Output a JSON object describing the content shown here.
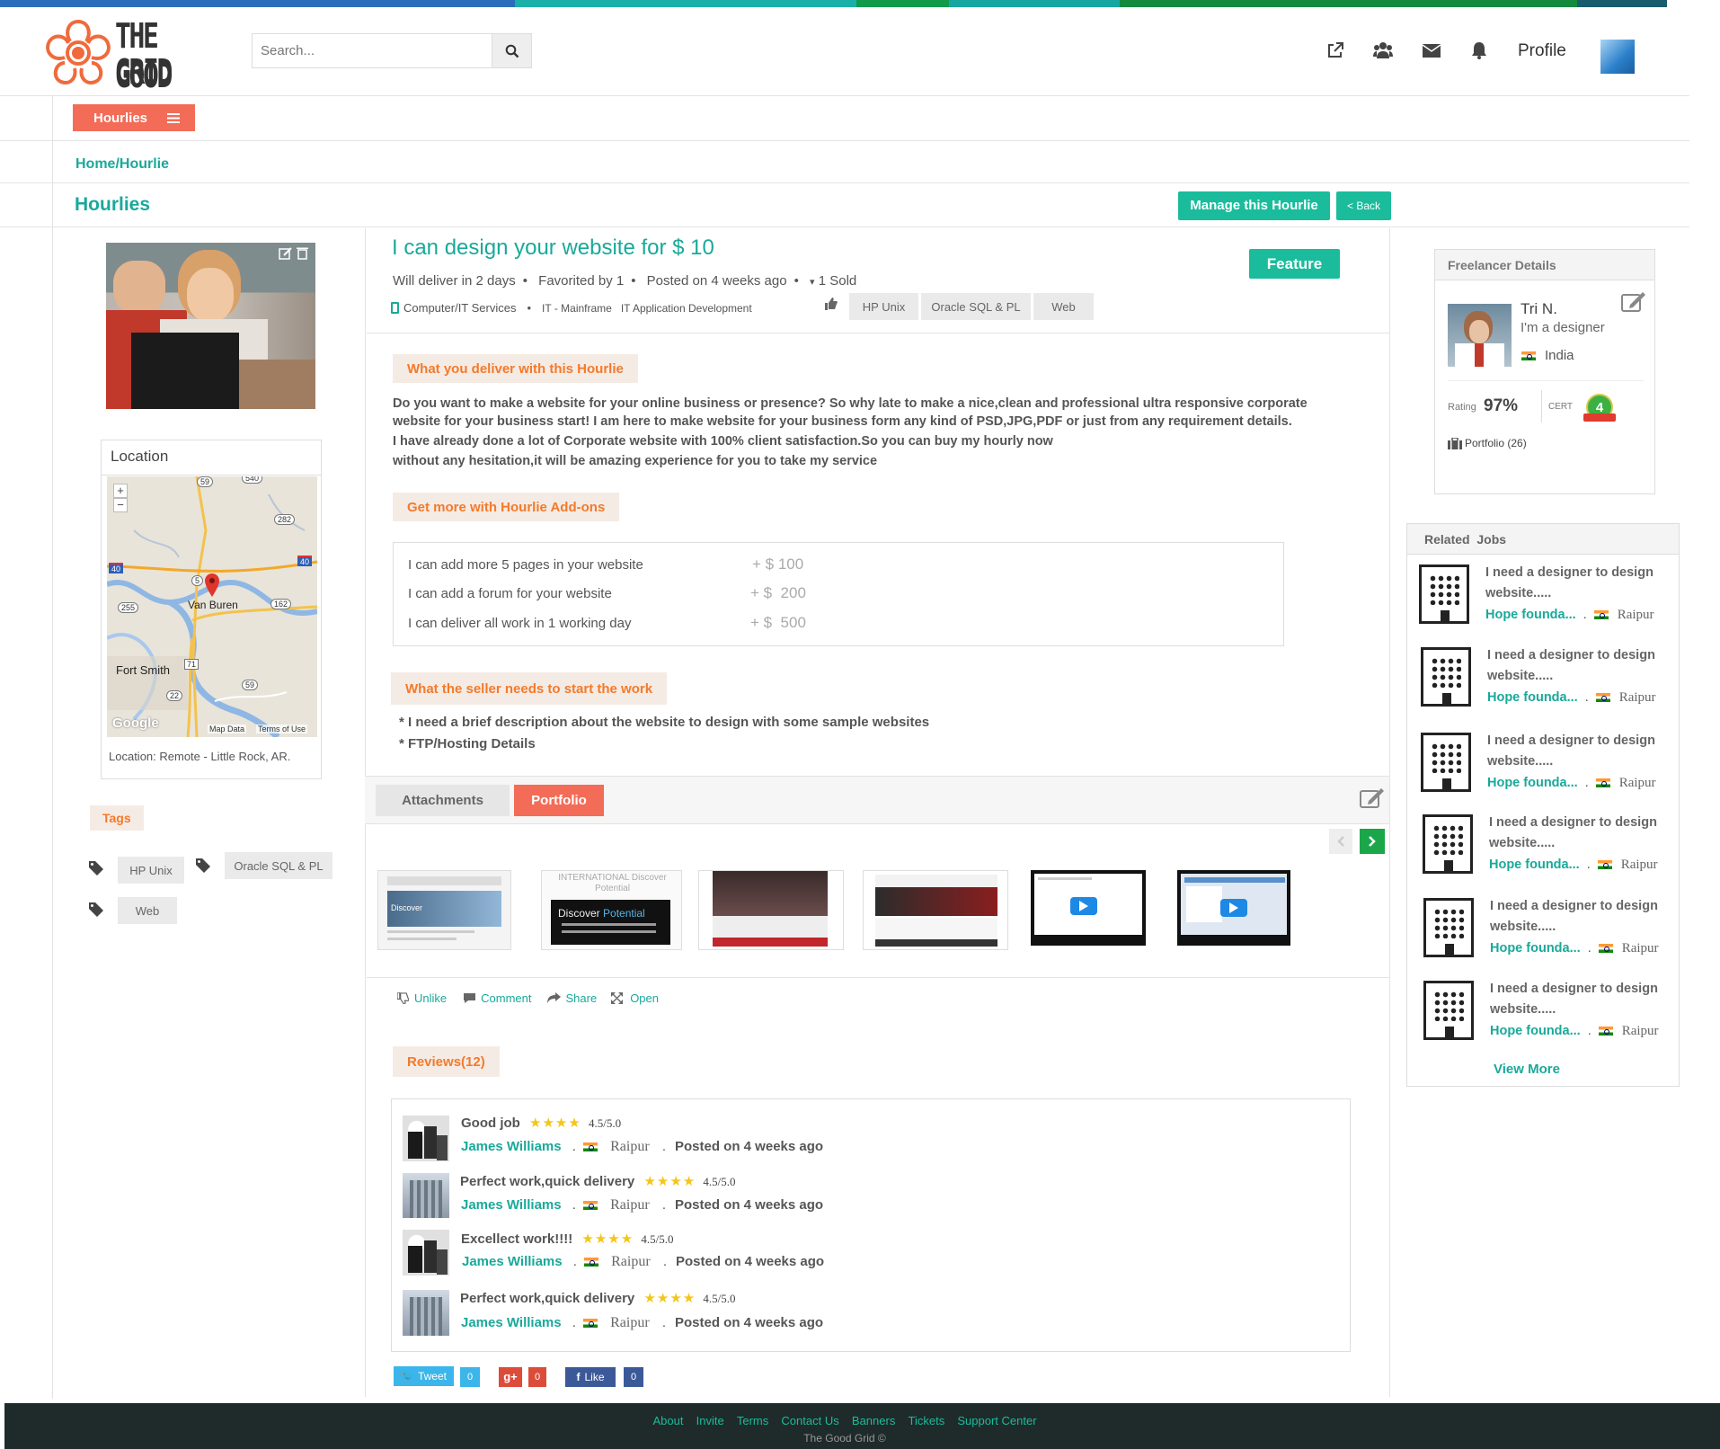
{
  "header": {
    "logo_text_top": "THE GOOD",
    "logo_text_bottom": "GRID",
    "search_placeholder": "Search...",
    "profile_label": "Profile",
    "icons": [
      "external-link-icon",
      "users-icon",
      "envelope-icon",
      "bell-icon"
    ]
  },
  "nav": {
    "menu_button_label": "Hourlies",
    "breadcrumb": "Home/Hourlie",
    "section_title": "Hourlies",
    "manage_button": "Manage this Hourlie",
    "back_button": "< Back"
  },
  "hourlie": {
    "title": "I can design your website for $ 10",
    "feature_button": "Feature",
    "deliver": "Will deliver in 2 days",
    "favorited": "Favorited by 1",
    "posted": "Posted on 4 weeks ago",
    "sold": "1 Sold",
    "category": "Computer/IT Services",
    "subcategory1": "IT - Mainframe",
    "subcategory2": "IT Application Development",
    "skills": [
      "HP Unix",
      "Oracle SQL & PL",
      "Web"
    ],
    "deliver_heading": "What you deliver with this Hourlie",
    "description": [
      "Do you want to make a website for your online business or presence? So why late to make a nice,clean and professional ultra responsive corporate",
      "website for your business start!   I am here to make website for your business form any kind of PSD,JPG,PDF or just from any requirement details.",
      "I have already done a lot of Corporate website with 100% client satisfaction.So you can buy my hourly now",
      "without any hesitation,it will be amazing experience for you to take my service"
    ],
    "addons_heading": "Get more with Hourlie Add-ons",
    "addons": [
      {
        "label": "I can add more 5 pages in your website",
        "price": "+ $ 100"
      },
      {
        "label": "I can add a forum for your website",
        "price": "+ $  200"
      },
      {
        "label": "I can deliver all work in 1 working day",
        "price": "+ $  500"
      }
    ],
    "requirements_heading": "What the seller needs to start the work",
    "requirements": [
      "* I need a brief description about the website to design with some sample websites",
      "* FTP/Hosting Details"
    ]
  },
  "tabs": {
    "attachments": "Attachments",
    "portfolio": "Portfolio"
  },
  "portfolio_thumbs": [
    "Discover",
    "INTERNATIONAL Discover Potential",
    "shoe-store",
    "shoe-store-2",
    "video",
    "video-2"
  ],
  "actions": {
    "unlike": "Unlike",
    "comment": "Comment",
    "share": "Share",
    "open": "Open"
  },
  "reviews": {
    "heading": "Reviews(12)",
    "items": [
      {
        "title": "Good job",
        "stars": "★★★★",
        "rating": "4.5/5.0",
        "name": "James Williams",
        "city": "Raipur",
        "posted": "Posted on 4 weeks ago"
      },
      {
        "title": "Perfect work,quick delivery",
        "stars": "★★★★",
        "rating": "4.5/5.0",
        "name": "James Williams",
        "city": "Raipur",
        "posted": "Posted on 4 weeks ago"
      },
      {
        "title": "Excellect work!!!!",
        "stars": "★★★★",
        "rating": "4.5/5.0",
        "name": "James Williams",
        "city": "Raipur",
        "posted": "Posted on 4 weeks ago"
      },
      {
        "title": "Perfect work,quick delivery",
        "stars": "★★★★",
        "rating": "4.5/5.0",
        "name": "James Williams",
        "city": "Raipur",
        "posted": "Posted on 4 weeks ago"
      }
    ]
  },
  "social": {
    "tweet": "Tweet",
    "tweet_count": "0",
    "gplus": "g+",
    "gplus_count": "0",
    "like": "Like",
    "like_count": "0"
  },
  "location": {
    "heading": "Location",
    "text": "Location: Remote - Little Rock, AR.",
    "map_labels": {
      "city1": "Van Buren",
      "city2": "Fort Smith",
      "google": "Google",
      "map_data": "Map Data",
      "terms": "Terms of Use",
      "r59": "59",
      "r540": "540",
      "r282": "282",
      "r40a": "40",
      "r40b": "40",
      "r255": "255",
      "r162": "162",
      "r71": "71",
      "r59b": "59",
      "r22": "22",
      "r5": "5"
    },
    "zoom_in": "+",
    "zoom_out": "−"
  },
  "tags": {
    "heading": "Tags",
    "items": [
      "HP Unix",
      "Oracle SQL & PL",
      "Web"
    ]
  },
  "freelancer": {
    "heading": "Freelancer Details",
    "name": "Tri N.",
    "tagline": "I'm a designer",
    "country": "India",
    "rating_label": "Rating",
    "rating": "97%",
    "cert_label": "CERT",
    "cert_level": "4",
    "portfolio": "Portfolio (26)"
  },
  "related_jobs": {
    "heading": "Related  Jobs",
    "items": [
      {
        "title": "I need a designer to design website.....",
        "company": "Hope founda...",
        "city": "Raipur"
      },
      {
        "title": "I need a designer to design website.....",
        "company": "Hope founda...",
        "city": "Raipur"
      },
      {
        "title": "I need a designer to design website.....",
        "company": "Hope founda...",
        "city": "Raipur"
      },
      {
        "title": "I need a designer to design website.....",
        "company": "Hope founda...",
        "city": "Raipur"
      },
      {
        "title": "I need a designer to design website.....",
        "company": "Hope founda...",
        "city": "Raipur"
      },
      {
        "title": "I need a designer to design website.....",
        "company": "Hope founda...",
        "city": "Raipur"
      }
    ],
    "view_more": "View More"
  },
  "footer": {
    "links": [
      "About",
      "Invite",
      "Terms",
      "Contact Us",
      "Banners",
      "Tickets",
      "Support Center"
    ],
    "copyright": "The Good Grid ©"
  },
  "colors": {
    "teal": "#1abc9c",
    "orange": "#f47a2a",
    "menu_red": "#f36c57",
    "footer_bg": "#1f2a2a"
  }
}
